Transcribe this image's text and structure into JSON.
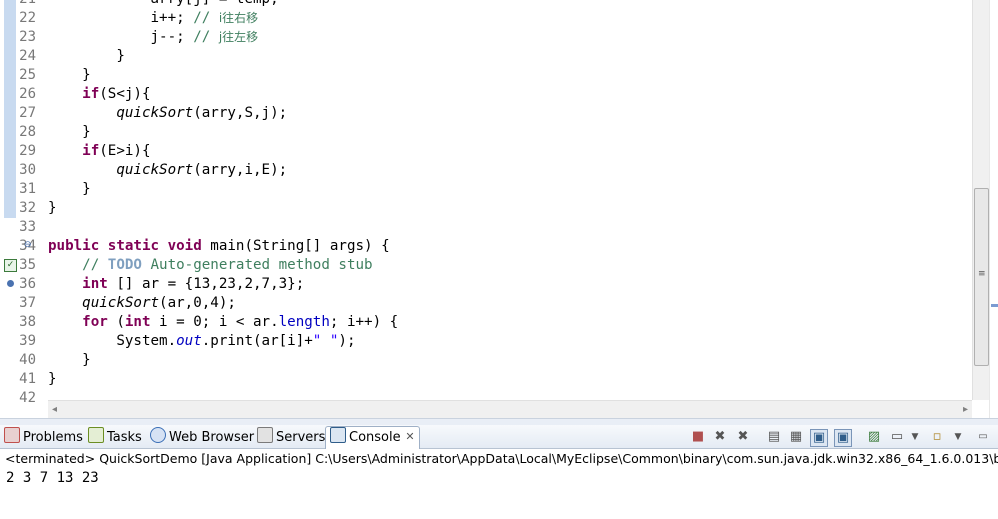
{
  "editor": {
    "lines": [
      {
        "n": "21",
        "segs": [
          {
            "t": "            arry[j] = temp;",
            "c": ""
          }
        ]
      },
      {
        "n": "22",
        "segs": [
          {
            "t": "            i++; ",
            "c": ""
          },
          {
            "t": "// ",
            "c": "cm"
          },
          {
            "t": "i往右移",
            "c": "cm cjk"
          }
        ]
      },
      {
        "n": "23",
        "segs": [
          {
            "t": "            j--; ",
            "c": ""
          },
          {
            "t": "// ",
            "c": "cm"
          },
          {
            "t": "j往左移",
            "c": "cm cjk"
          }
        ]
      },
      {
        "n": "24",
        "segs": [
          {
            "t": "        }",
            "c": ""
          }
        ]
      },
      {
        "n": "25",
        "segs": [
          {
            "t": "    }",
            "c": ""
          }
        ]
      },
      {
        "n": "26",
        "segs": [
          {
            "t": "    ",
            "c": ""
          },
          {
            "t": "if",
            "c": "kw"
          },
          {
            "t": "(S<j){",
            "c": ""
          }
        ]
      },
      {
        "n": "27",
        "segs": [
          {
            "t": "        ",
            "c": ""
          },
          {
            "t": "quickSort",
            "c": "it"
          },
          {
            "t": "(arry,S,j);",
            "c": ""
          }
        ]
      },
      {
        "n": "28",
        "segs": [
          {
            "t": "    }",
            "c": ""
          }
        ]
      },
      {
        "n": "29",
        "segs": [
          {
            "t": "    ",
            "c": ""
          },
          {
            "t": "if",
            "c": "kw"
          },
          {
            "t": "(E>i){",
            "c": ""
          }
        ]
      },
      {
        "n": "30",
        "segs": [
          {
            "t": "        ",
            "c": ""
          },
          {
            "t": "quickSort",
            "c": "it"
          },
          {
            "t": "(arry,i,E);",
            "c": ""
          }
        ]
      },
      {
        "n": "31",
        "segs": [
          {
            "t": "    }",
            "c": ""
          }
        ]
      },
      {
        "n": "32",
        "segs": [
          {
            "t": "}",
            "c": ""
          }
        ]
      },
      {
        "n": "33",
        "segs": [
          {
            "t": "",
            "c": ""
          }
        ]
      },
      {
        "n": "34",
        "segs": [
          {
            "t": "public static void",
            "c": "kw"
          },
          {
            "t": " main(String[] args) {",
            "c": ""
          }
        ]
      },
      {
        "n": "35",
        "segs": [
          {
            "t": "    ",
            "c": ""
          },
          {
            "t": "// ",
            "c": "cm"
          },
          {
            "t": "TODO",
            "c": "todo"
          },
          {
            "t": " Auto-generated method stub",
            "c": "cm"
          }
        ]
      },
      {
        "n": "36",
        "segs": [
          {
            "t": "    ",
            "c": ""
          },
          {
            "t": "int",
            "c": "kw"
          },
          {
            "t": " [] ar = {13,23,2,7,3};",
            "c": ""
          }
        ]
      },
      {
        "n": "37",
        "segs": [
          {
            "t": "    ",
            "c": ""
          },
          {
            "t": "quickSort",
            "c": "it"
          },
          {
            "t": "(ar,0,4);",
            "c": ""
          }
        ]
      },
      {
        "n": "38",
        "segs": [
          {
            "t": "    ",
            "c": ""
          },
          {
            "t": "for",
            "c": "kw"
          },
          {
            "t": " (",
            "c": ""
          },
          {
            "t": "int",
            "c": "kw"
          },
          {
            "t": " i = 0; i < ar.",
            "c": ""
          },
          {
            "t": "length",
            "c": "fld"
          },
          {
            "t": "; i++) {",
            "c": ""
          }
        ]
      },
      {
        "n": "39",
        "segs": [
          {
            "t": "        System.",
            "c": ""
          },
          {
            "t": "out",
            "c": "sti"
          },
          {
            "t": ".print(ar[i]+",
            "c": ""
          },
          {
            "t": "\" \"",
            "c": "str"
          },
          {
            "t": ");",
            "c": ""
          }
        ]
      },
      {
        "n": "40",
        "segs": [
          {
            "t": "    }",
            "c": ""
          }
        ]
      },
      {
        "n": "41",
        "segs": [
          {
            "t": "}",
            "c": ""
          }
        ]
      },
      {
        "n": "42",
        "segs": [
          {
            "t": "",
            "c": ""
          }
        ]
      }
    ]
  },
  "tabs": [
    {
      "label": "Problems",
      "icon": "problems-icon",
      "color": "#c0504d"
    },
    {
      "label": "Tasks",
      "icon": "tasks-icon",
      "color": "#6b8e23"
    },
    {
      "label": "Web Browser",
      "icon": "web-browser-icon",
      "color": "#3b6fb6"
    },
    {
      "label": "Servers",
      "icon": "servers-icon",
      "color": "#7a7a7a"
    },
    {
      "label": "Console",
      "icon": "console-icon",
      "color": "#2f5d8a",
      "close": "✕"
    }
  ],
  "console": {
    "status": "<terminated> QuickSortDemo [Java Application] C:\\Users\\Administrator\\AppData\\Local\\MyEclipse\\Common\\binary\\com.sun.java.jdk.win32.x86_64_1.6.0.013\\bin\\javaw.exe",
    "output": "2 3 7 13 23"
  },
  "toolbar": {
    "icons": [
      "terminate-icon",
      "remove-launch-icon",
      "remove-all-terminated-icon",
      "clear-console-icon",
      "scroll-lock-icon",
      "word-wrap-icon",
      "show-on-output-icon",
      "pin-console-icon",
      "open-console-icon",
      "display-selected-console-icon",
      "view-menu-icon",
      "minimize-icon"
    ]
  }
}
